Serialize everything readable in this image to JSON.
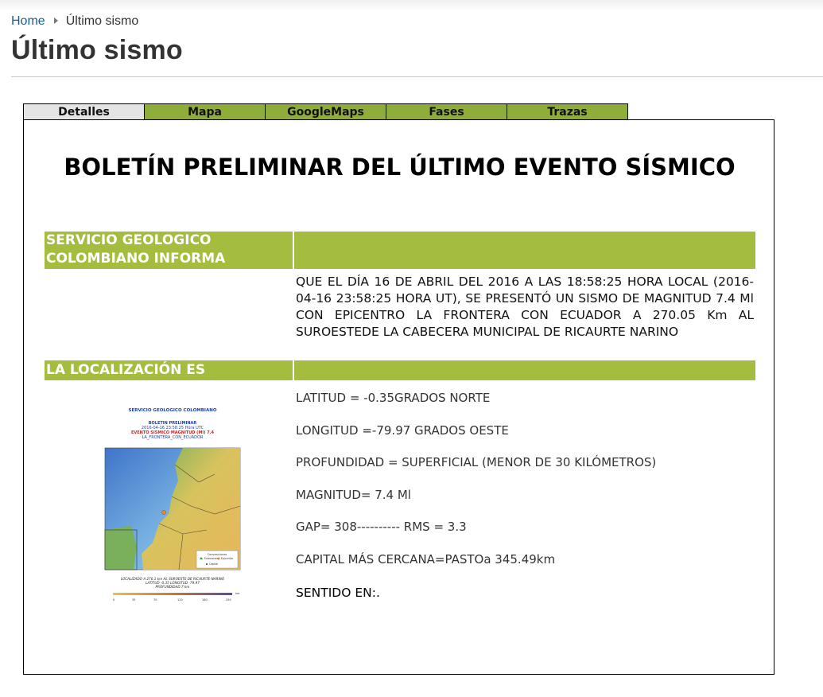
{
  "breadcrumb": {
    "home": "Home",
    "current": "Último sismo"
  },
  "page_title": "Último sismo",
  "tabs": [
    "Detalles",
    "Mapa",
    "GoogleMaps",
    "Fases",
    "Trazas"
  ],
  "active_tab": "Detalles",
  "bulletin": {
    "title": "BOLETÍN PRELIMINAR DEL ÚLTIMO EVENTO SÍSMICO",
    "section1_line1": "SERVICIO GEOLOGICO",
    "section1_line2": "COLOMBIANO INFORMA",
    "info_text": "QUE EL DÍA 16 DE ABRIL DEL 2016  A LAS 18:58:25 HORA LOCAL (2016-04-16 23:58:25 HORA UT), SE PRESENTÓ UN SISMO DE MAGNITUD 7.4 Ml CON EPICENTRO LA FRONTERA CON ECUADOR A 270.05 Km  AL SUROESTEDE LA CABECERA MUNICIPAL DE RICAURTE NARINO",
    "section2": "LA LOCALIZACIÓN ES",
    "latitud": "LATITUD = -0.35GRADOS NORTE",
    "longitud": "LONGITUD =-79.97 GRADOS OESTE",
    "profundidad": "PROFUNDIDAD = SUPERFICIAL (MENOR DE 30 KILÓMETROS)",
    "magnitud": "MAGNITUD= 7.4 Ml",
    "gap": "GAP= 308---------- RMS = 3.3",
    "capital": "CAPITAL MÁS CERCANA=PASTOa 345.49km",
    "sentido": "SENTIDO EN:."
  },
  "map_image": {
    "header1": "SERVICIO GEOLOGICO COLOMBIANO",
    "header2": "BOLETIN PRELIMINAR",
    "header3": "2016-04-16   23:58:25   Hora UTC",
    "header4": "EVENTO SISMICO MAGNITUD (Ml) 7.4",
    "header5": "LA_FRONTERA_CON_ECUADOR",
    "legend_title": "Convenciones",
    "legend_estaciones": "Estaciones",
    "legend_epicentro": "Epicentro",
    "legend_capital": "Capital",
    "footer1": "LOCALIZADO A 270.1 km AL SUROESTE DE RICAURTE-NARINO",
    "footer2": "LATITUD -0.35 LONGITUD -79.97",
    "footer3": "PROFUNDIDAD 7 km",
    "scale_labels": [
      "0",
      "35",
      "70",
      "120",
      "180",
      "250"
    ],
    "scale_unit": "km"
  },
  "colors": {
    "tab_green": "#8fad3a",
    "section_green": "#a4bd3f",
    "link": "#1a5e96"
  }
}
